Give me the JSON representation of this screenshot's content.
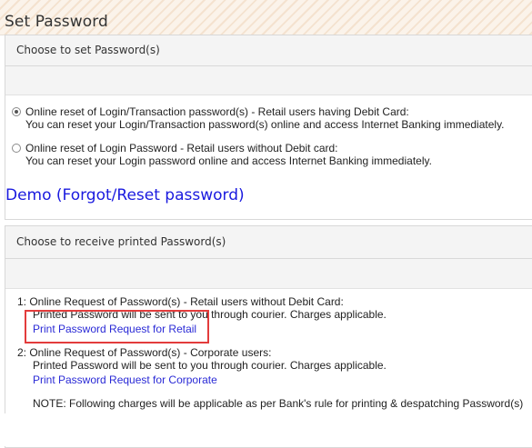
{
  "page": {
    "title": "Set Password"
  },
  "reset_panel": {
    "heading": "Choose to set Password(s)",
    "options": [
      {
        "title": "Online reset of Login/Transaction password(s) - Retail users having Debit Card:",
        "desc": "You can reset your Login/Transaction password(s) online and access Internet Banking immediately.",
        "selected": true
      },
      {
        "title": "Online reset of Login Password - Retail users without Debit card:",
        "desc": "You can reset your Login password online and access Internet Banking immediately.",
        "selected": false
      }
    ]
  },
  "demo_link": "Demo (Forgot/Reset password)",
  "printed_panel": {
    "heading": "Choose to receive printed Password(s)",
    "items": [
      {
        "title": "1: Online Request of Password(s) - Retail users without Debit Card:",
        "desc": "Printed Password will be sent to you through courier. Charges applicable.",
        "link": "Print Password Request for Retail"
      },
      {
        "title": "2: Online Request of Password(s) - Corporate users:",
        "desc": "Printed Password will be sent to you through courier. Charges applicable.",
        "link": "Print Password Request for Corporate"
      }
    ],
    "note": "NOTE: Following charges will be applicable as per Bank's rule for printing & despatching Password(s)"
  },
  "colors": {
    "link": "#2a2ad6",
    "highlight": "#e33c3c",
    "panel_head": "#f4f4f4"
  }
}
